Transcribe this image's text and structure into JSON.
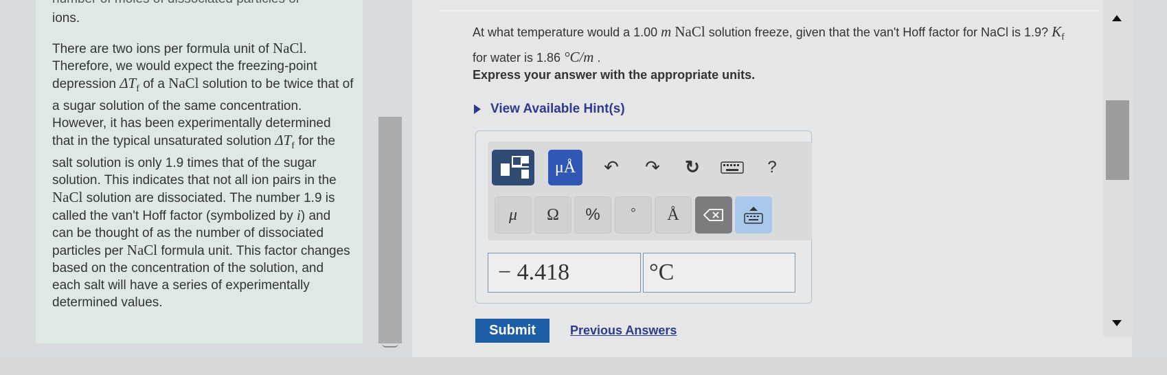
{
  "left_panel": {
    "cut_line": "number of moles of dissociated particles or",
    "ions": "ions.",
    "paragraph": [
      {
        "t": "There are two ions per formula unit of "
      },
      {
        "m": "NaCl"
      },
      {
        "t": "."
      },
      {
        "br": true
      },
      {
        "t": "Therefore, we would expect the freezing-point depression "
      },
      {
        "mi": "ΔT"
      },
      {
        "sub": "f"
      },
      {
        "t": " of a "
      },
      {
        "m": "NaCl"
      },
      {
        "t": " solution to be twice that of a sugar solution of the same concentration. However, it has been experimentally determined that in the typical unsaturated solution "
      },
      {
        "mi": "ΔT"
      },
      {
        "sub": "f"
      },
      {
        "t": " for the salt solution is only 1.9 times that of the sugar solution. This indicates that not all ion pairs in the "
      },
      {
        "m": "NaCl"
      },
      {
        "t": " solution are dissociated. The number 1.9 is called the van't Hoff factor (symbolized by "
      },
      {
        "mi": "i"
      },
      {
        "t": ") and can be thought of as the number of dissociated particles per "
      },
      {
        "m": "NaCl"
      },
      {
        "t": " formula unit. This factor changes based on the concentration of the solution, and each salt will have a series of experimentally determined values."
      }
    ]
  },
  "question": {
    "p1": "At what temperature would a 1.00 ",
    "p1_m": "m",
    "p1_nacl": "NaCl",
    "p2": " solution freeze, given that the van't Hoff factor for NaCl is 1.9? ",
    "kf": "K",
    "kf_sub": "f",
    "p3": " for water is 1.86 ",
    "unit": "°C/m",
    "p4": " ."
  },
  "instruction": "Express your answer with the appropriate units.",
  "hint_label": "View Available Hint(s)",
  "toolbar": {
    "units_btn": "μÅ",
    "undo": "↶",
    "redo": "↷",
    "reset": "↻",
    "help": "?",
    "symbols": [
      "μ",
      "Ω",
      "%",
      "°",
      "Å"
    ]
  },
  "answer": {
    "value": "− 4.418",
    "unit": "°C"
  },
  "submit_label": "Submit",
  "previous_label": "Previous Answers"
}
